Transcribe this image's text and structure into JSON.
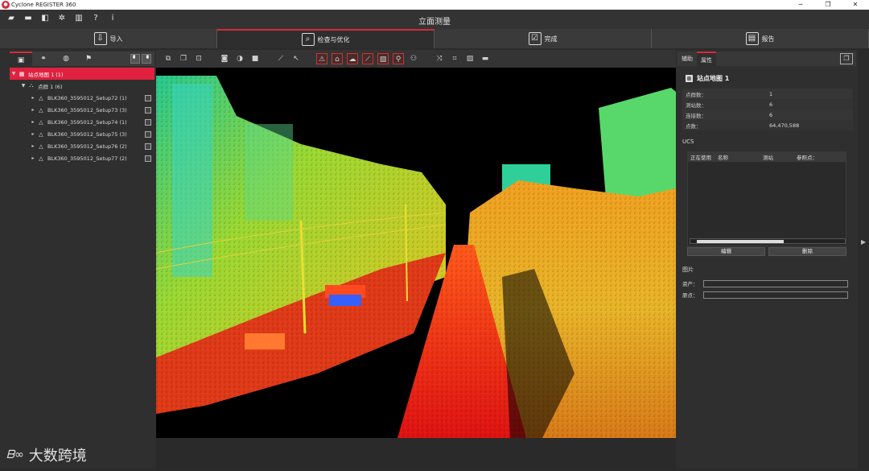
{
  "window": {
    "title": "Cyclone REGISTER 360",
    "controls": [
      "─",
      "❐",
      "✕"
    ]
  },
  "project_title": "立面测量",
  "menu_icons": [
    "open-folder-icon",
    "folder-icon",
    "import-icon",
    "settings-icon",
    "database-icon",
    "help-icon",
    "info-icon"
  ],
  "steps": [
    {
      "label": "导入",
      "icon": "⇩"
    },
    {
      "label": "检查与优化",
      "icon": "⌕"
    },
    {
      "label": "完成",
      "icon": "☑"
    },
    {
      "label": "报告",
      "icon": "▤"
    }
  ],
  "left_panel": {
    "tree": [
      {
        "label": "站点地图 1 (1)",
        "level": 0,
        "selected": true
      },
      {
        "label": "点群 1 (6)",
        "level": 1,
        "selected": false
      },
      {
        "label": "BLK360_3595012_Setup72 (1)",
        "level": 2,
        "selected": false
      },
      {
        "label": "BLK360_3595012_Setup73 (3)",
        "level": 2,
        "selected": false
      },
      {
        "label": "BLK360_3595012_Setup74 (1)",
        "level": 2,
        "selected": false
      },
      {
        "label": "BLK360_3595012_Setup75 (3)",
        "level": 2,
        "selected": false
      },
      {
        "label": "BLK360_3595012_Setup76 (2)",
        "level": 2,
        "selected": false
      },
      {
        "label": "BLK360_3595012_Setup77 (2)",
        "level": 2,
        "selected": false
      }
    ]
  },
  "right_panel": {
    "tabs": [
      "辅助",
      "属性"
    ],
    "header": "站点地图 1",
    "properties": [
      {
        "key": "点群数：",
        "value": "1"
      },
      {
        "key": "测站数：",
        "value": "6"
      },
      {
        "key": "连接数：",
        "value": "6"
      },
      {
        "key": "点数：",
        "value": "64,470,588"
      }
    ],
    "ucs_title": "UCS",
    "ucs_columns": [
      "正在使用",
      "名称",
      "测站",
      "参照点："
    ],
    "ucs_buttons": [
      "编辑",
      "删除"
    ],
    "images_title": "图片",
    "image_fields": [
      "资产：",
      "原点："
    ]
  },
  "watermark": {
    "logo": "ᗷ∞",
    "text": "大数跨境"
  },
  "colors": {
    "accent": "#d42b3a",
    "selected": "#e0213f",
    "background": "#2b2b2b"
  }
}
